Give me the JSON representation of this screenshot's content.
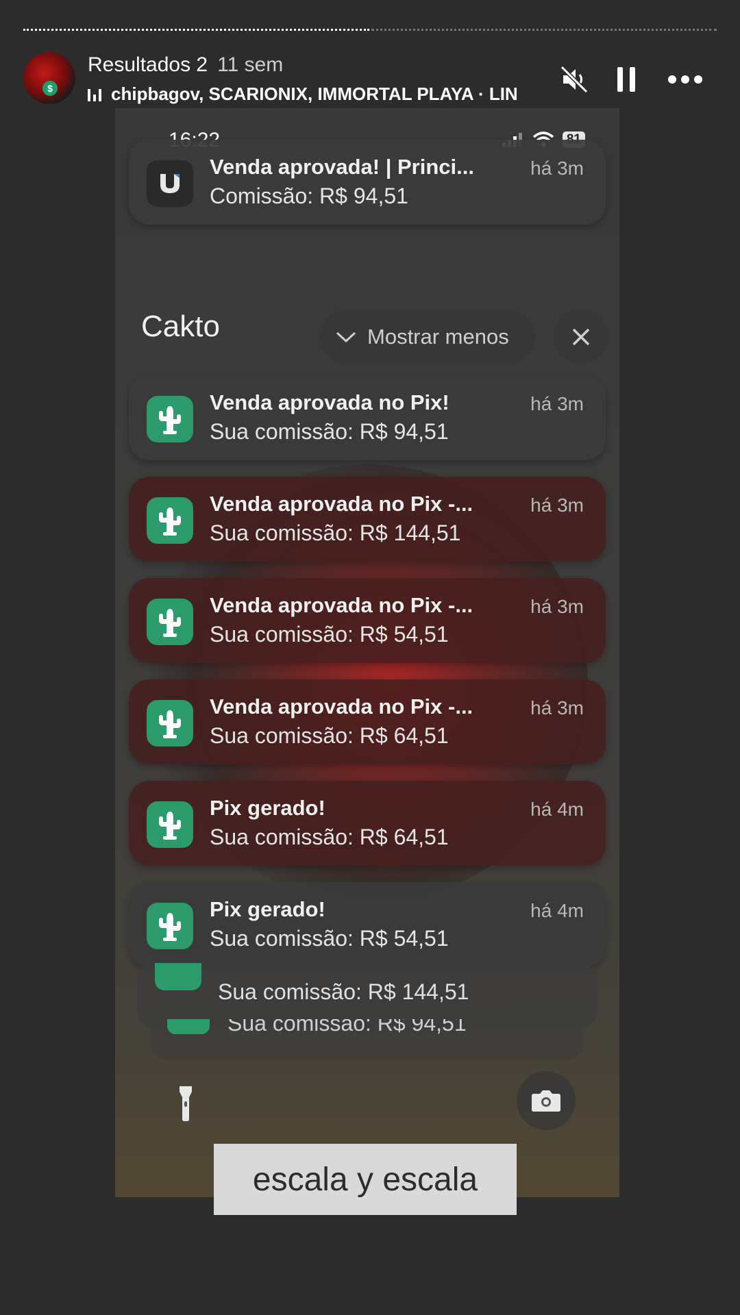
{
  "header": {
    "name": "Resultados 2",
    "time": "11 sem",
    "music": "chipbagov, SCARIONIX, IMMORTAL PLAYA · LIN"
  },
  "phone": {
    "status_time": "16:22",
    "battery": "81",
    "top_notification": {
      "title": "Venda aprovada! | Princi...",
      "body": "Comissão: R$ 94,51",
      "ago": "há 3m"
    },
    "group": {
      "app_name": "Cakto",
      "collapse_label": "Mostrar menos"
    },
    "notifications": [
      {
        "title": "Venda aprovada no Pix!",
        "body": "Sua comissão: R$ 94,51",
        "ago": "há 3m"
      },
      {
        "title": "Venda aprovada no Pix -...",
        "body": "Sua comissão: R$ 144,51",
        "ago": "há 3m"
      },
      {
        "title": "Venda aprovada no Pix -...",
        "body": "Sua comissão: R$ 54,51",
        "ago": "há 3m"
      },
      {
        "title": "Venda aprovada no Pix -...",
        "body": "Sua comissão: R$ 64,51",
        "ago": "há 3m"
      },
      {
        "title": "Pix gerado!",
        "body": "Sua comissão: R$ 64,51",
        "ago": "há 4m"
      },
      {
        "title": "Pix gerado!",
        "body": "Sua comissão: R$ 54,51",
        "ago": "há 4m"
      }
    ],
    "stacked": [
      {
        "body": "Sua comissão: R$ 144,51"
      },
      {
        "body": "Sua comissão: R$ 94,51"
      }
    ]
  },
  "caption": "escala y escala",
  "icons": {
    "mute": "speaker-muted-icon",
    "pause": "pause-icon",
    "more": "more-icon",
    "flashlight": "flashlight-icon",
    "camera": "camera-icon"
  },
  "colors": {
    "app_icon": "#2c9b6b",
    "background": "#2c2c2c"
  }
}
